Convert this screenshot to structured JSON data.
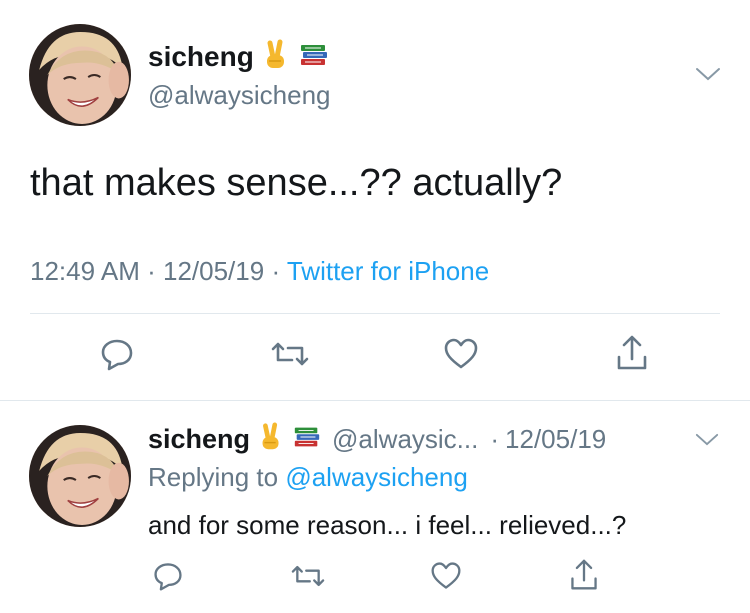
{
  "main_tweet": {
    "display_name": "sicheng",
    "handle": "@alwaysicheng",
    "text": "that makes sense...?? actually?",
    "time": "12:49 AM",
    "date": "12/05/19",
    "source": "Twitter for iPhone",
    "emoji_names": [
      "victory-hand-icon",
      "books-icon"
    ]
  },
  "reply_tweet": {
    "display_name": "sicheng",
    "handle_truncated": "@alwaysic...",
    "date": "12/05/19",
    "replying_to_label": "Replying to",
    "replying_to_handle": "@alwaysicheng",
    "text": "and for some reason... i feel... relieved...?"
  },
  "actions": [
    "reply-icon",
    "retweet-icon",
    "like-icon",
    "share-icon"
  ],
  "colors": {
    "link": "#1da1f2",
    "muted": "#657786",
    "text": "#14171a",
    "divider": "#e1e8ed"
  }
}
